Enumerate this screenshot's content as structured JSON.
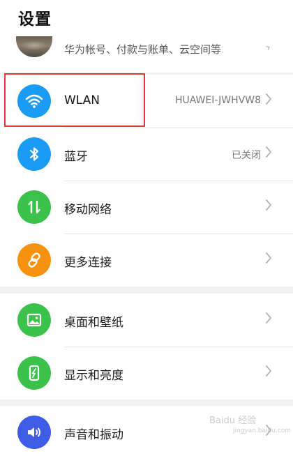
{
  "header": {
    "title": "设置",
    "account_subtitle": "华为帐号、付款与账单、云空间等"
  },
  "groups": [
    {
      "items": [
        {
          "key": "wlan",
          "label": "WLAN",
          "value": "HUAWEI-JWHVW8",
          "icon": "wifi-icon",
          "color": "#1a9cf5"
        },
        {
          "key": "bluetooth",
          "label": "蓝牙",
          "value": "已关闭",
          "icon": "bluetooth-icon",
          "color": "#1a9cf5"
        },
        {
          "key": "mobile",
          "label": "移动网络",
          "value": "",
          "icon": "mobile-data-icon",
          "color": "#3cc24a"
        },
        {
          "key": "more",
          "label": "更多连接",
          "value": "",
          "icon": "link-icon",
          "color": "#f7920f"
        }
      ]
    },
    {
      "items": [
        {
          "key": "wallpaper",
          "label": "桌面和壁纸",
          "value": "",
          "icon": "picture-icon",
          "color": "#3cc24a"
        },
        {
          "key": "display",
          "label": "显示和亮度",
          "value": "",
          "icon": "brightness-icon",
          "color": "#3cc24a"
        }
      ]
    },
    {
      "items": [
        {
          "key": "sound",
          "label": "声音和振动",
          "value": "",
          "icon": "speaker-icon",
          "color": "#3e5ce6"
        }
      ]
    }
  ],
  "watermark": {
    "brand": "Baidu 经验",
    "url": "jingyan.baidu.com"
  }
}
